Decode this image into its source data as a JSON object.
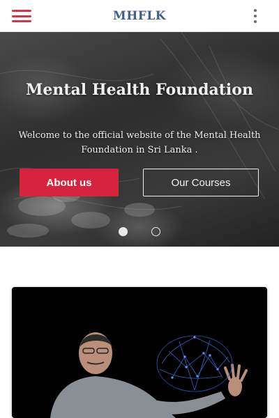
{
  "header": {
    "brand": "MHFLK",
    "menu_icon": "hamburger-menu-icon",
    "more_icon": "more-vertical-icon",
    "accent_color": "#d6334a",
    "brand_color": "#3f5f8f"
  },
  "hero": {
    "title": "Mental Health Foundation",
    "subtitle": "Welcome to the official website of the Mental Health Foundation in Sri Lanka .",
    "primary_button": "About us",
    "secondary_button": "Our Courses",
    "primary_color": "#d6243f",
    "slides": 2,
    "active_slide": 1
  },
  "featured_media": {
    "icon": "brain-network-image",
    "background_color": "#000000"
  }
}
